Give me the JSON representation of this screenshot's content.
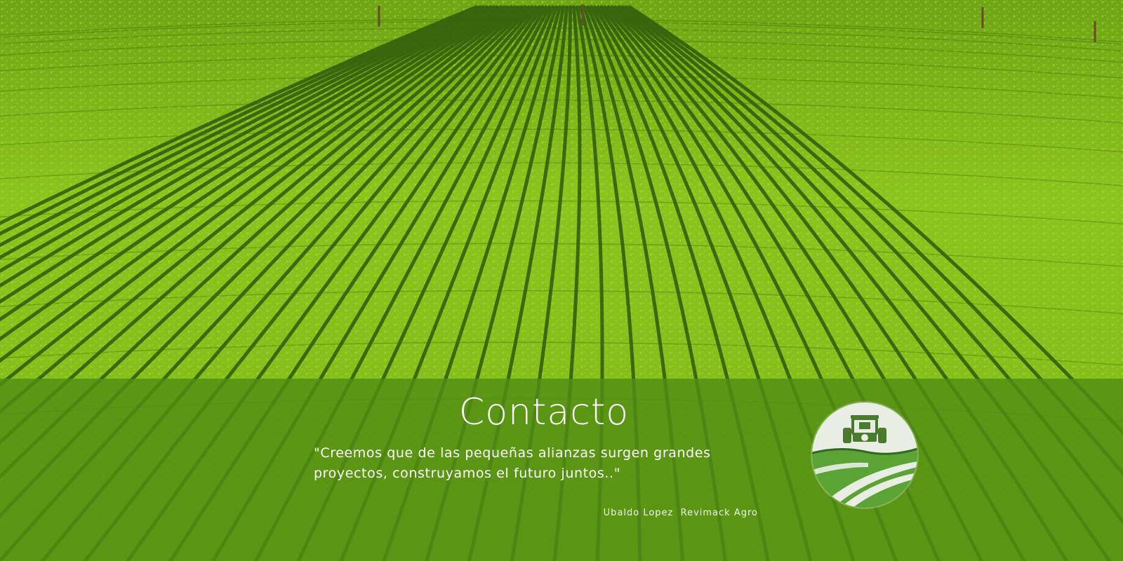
{
  "hero": {
    "title": "Contacto",
    "quote": "\"Creemos que de las pequeñas alianzas surgen grandes proyectos, construyamos el futuro juntos..\"",
    "author": "Ubaldo Lopez  Revimack Agro"
  },
  "logo": {
    "icon": "tractor-field-icon"
  },
  "colors": {
    "field_light": "#8fc61f",
    "field_dark": "#2f5a0c",
    "overlay": "#528c14",
    "text": "#ffffff",
    "logo_bg": "#e9eee4",
    "logo_green": "#3f8a2a"
  }
}
